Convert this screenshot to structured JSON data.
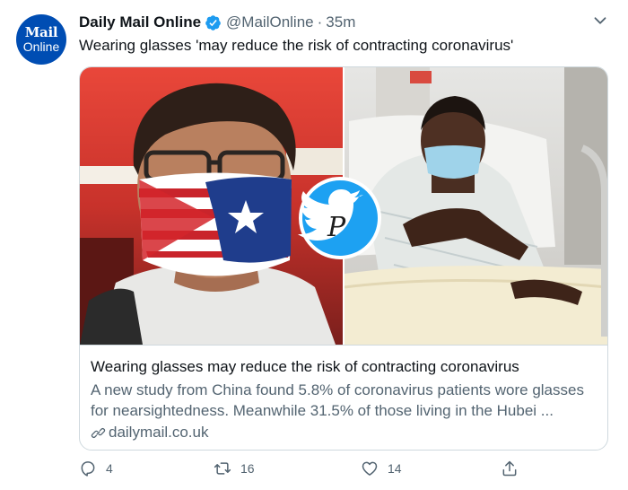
{
  "account": {
    "avatar_line1": "Mail",
    "avatar_line2": "Online",
    "display_name": "Daily Mail Online",
    "handle": "@MailOnline",
    "separator": "·",
    "timestamp": "35m"
  },
  "tweet": {
    "text": "Wearing glasses 'may reduce the risk of contracting coronavirus'"
  },
  "card": {
    "title": "Wearing glasses may reduce the risk of contracting coronavirus",
    "description": "A new study from China found 5.8% of coronavirus patients wore glasses for nearsightedness. Meanwhile 31.5% of those living in the Hubei ...",
    "domain": "dailymail.co.uk",
    "watermark_letter": "P"
  },
  "actions": {
    "replies": "4",
    "retweets": "16",
    "likes": "14"
  },
  "colors": {
    "avatar_bg": "#004db3",
    "verified": "#1d9bf0",
    "text_primary": "#0f1419",
    "text_secondary": "#536471",
    "border": "#cfd9de",
    "watermark_bg": "#1da1f2"
  },
  "icons": [
    "verified-badge-icon",
    "chevron-down-icon",
    "link-icon",
    "reply-icon",
    "retweet-icon",
    "like-icon",
    "share-icon",
    "bird-icon"
  ]
}
